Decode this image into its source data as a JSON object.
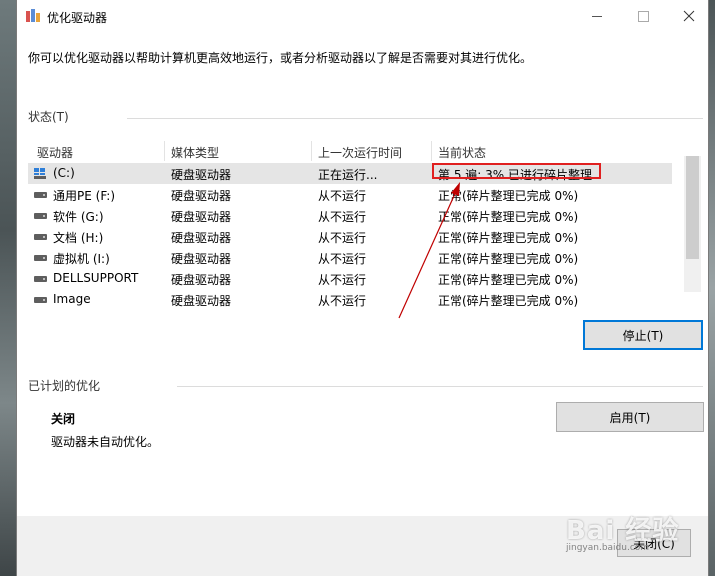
{
  "window": {
    "title": "优化驱动器",
    "description": "你可以优化驱动器以帮助计算机更高效地运行，或者分析驱动器以了解是否需要对其进行优化。"
  },
  "status_section": {
    "label": "状态(T)",
    "columns": [
      "驱动器",
      "媒体类型",
      "上一次运行时间",
      "当前状态"
    ],
    "rows": [
      {
        "drive": "(C:)",
        "media": "硬盘驱动器",
        "last_run": "正在运行...",
        "status": "第 5 遍: 3% 已进行碎片整理",
        "icon": "windows-drive-icon"
      },
      {
        "drive": "通用PE (F:)",
        "media": "硬盘驱动器",
        "last_run": "从不运行",
        "status": "正常(碎片整理已完成 0%)",
        "icon": "hard-drive-icon"
      },
      {
        "drive": "软件 (G:)",
        "media": "硬盘驱动器",
        "last_run": "从不运行",
        "status": "正常(碎片整理已完成 0%)",
        "icon": "hard-drive-icon"
      },
      {
        "drive": "文档 (H:)",
        "media": "硬盘驱动器",
        "last_run": "从不运行",
        "status": "正常(碎片整理已完成 0%)",
        "icon": "hard-drive-icon"
      },
      {
        "drive": "虚拟机 (I:)",
        "media": "硬盘驱动器",
        "last_run": "从不运行",
        "status": "正常(碎片整理已完成 0%)",
        "icon": "hard-drive-icon"
      },
      {
        "drive": "DELLSUPPORT",
        "media": "硬盘驱动器",
        "last_run": "从不运行",
        "status": "正常(碎片整理已完成 0%)",
        "icon": "hard-drive-icon"
      },
      {
        "drive": "Image",
        "media": "硬盘驱动器",
        "last_run": "从不运行",
        "status": "正常(碎片整理已完成 0%)",
        "icon": "hard-drive-icon"
      }
    ],
    "stop_button": "停止(T)"
  },
  "schedule_section": {
    "label": "已计划的优化",
    "state": "关闭",
    "detail": "驱动器未自动优化。",
    "enable_button": "启用(T)"
  },
  "footer": {
    "close_button": "关闭(C)"
  },
  "watermark": {
    "main": "Bai 经验",
    "sub": "jingyan.baidu.com"
  },
  "colors": {
    "highlight_box": "#e02020",
    "annotation_arrow": "#c00000",
    "focus_border": "#0078d7"
  }
}
